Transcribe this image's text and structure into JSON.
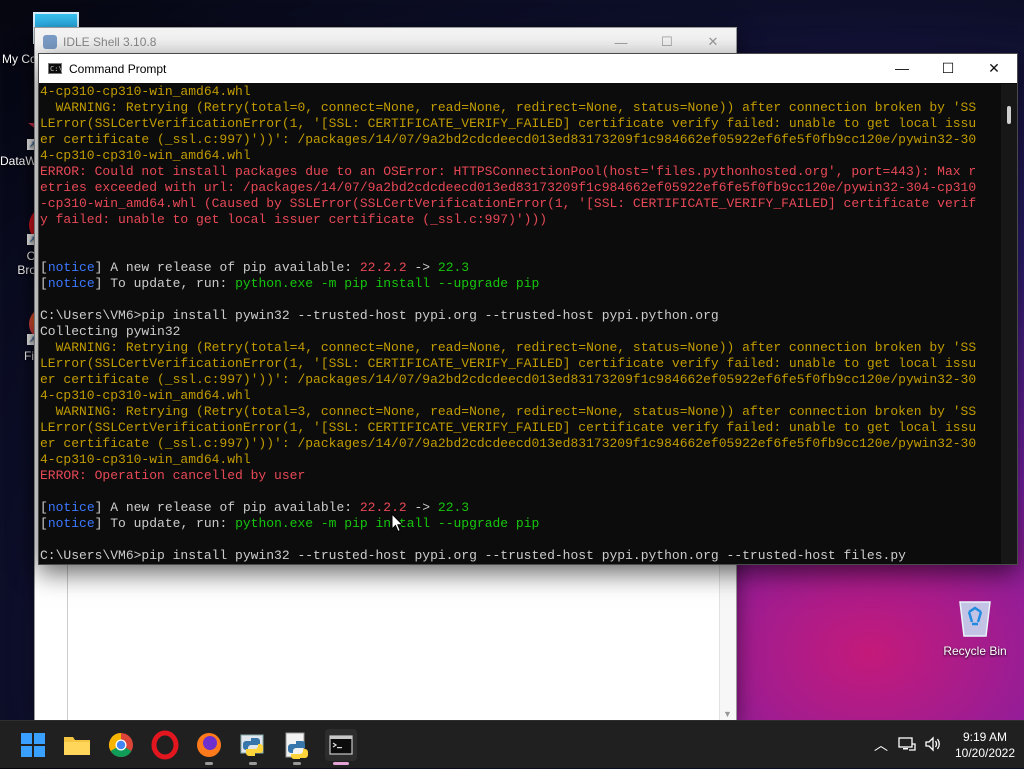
{
  "desktop": {
    "icons": [
      {
        "label": "My Co"
      },
      {
        "label": "DataW"
      },
      {
        "label": "O\nBro"
      },
      {
        "label": "Fi"
      }
    ],
    "recycle_bin": {
      "label": "Recycle Bin"
    }
  },
  "idle_window": {
    "title": "IDLE Shell 3.10.8",
    "minimize": "—",
    "maximize": "☐",
    "close": "✕"
  },
  "cmd_window": {
    "title": "Command Prompt",
    "icon_text": "C:\\",
    "minimize": "—",
    "maximize": "☐",
    "close": "✕",
    "lines": [
      [
        {
          "t": "4-cp310-cp310-win_amd64.whl",
          "c": "y"
        }
      ],
      [
        {
          "t": "  WARNING: Retrying (Retry(total=0, connect=None, read=None, redirect=None, status=None)) after connection broken by 'SS",
          "c": "y"
        }
      ],
      [
        {
          "t": "LError(SSLCertVerificationError(1, '[SSL: CERTIFICATE_VERIFY_FAILED] certificate verify failed: unable to get local issu",
          "c": "y"
        }
      ],
      [
        {
          "t": "er certificate (_ssl.c:997)'))': /packages/14/07/9a2bd2cdcdeecd013ed83173209f1c984662ef05922ef6fe5f0fb9cc120e/pywin32-30",
          "c": "y"
        }
      ],
      [
        {
          "t": "4-cp310-cp310-win_amd64.whl",
          "c": "y"
        }
      ],
      [
        {
          "t": "ERROR: Could not install packages due to an OSError: HTTPSConnectionPool(host='files.pythonhosted.org', port=443): Max r",
          "c": "r"
        }
      ],
      [
        {
          "t": "etries exceeded with url: /packages/14/07/9a2bd2cdcdeecd013ed83173209f1c984662ef05922ef6fe5f0fb9cc120e/pywin32-304-cp310",
          "c": "r"
        }
      ],
      [
        {
          "t": "-cp310-win_amd64.whl (Caused by SSLError(SSLCertVerificationError(1, '[SSL: CERTIFICATE_VERIFY_FAILED] certificate verif",
          "c": "r"
        }
      ],
      [
        {
          "t": "y failed: unable to get local issuer certificate (_ssl.c:997)')))",
          "c": "r"
        }
      ],
      [
        {
          "t": ""
        }
      ],
      [
        {
          "t": ""
        }
      ],
      [
        {
          "t": "["
        },
        {
          "t": "notice",
          "c": "b"
        },
        {
          "t": "] A new release of pip available: "
        },
        {
          "t": "22.2.2",
          "c": "r"
        },
        {
          "t": " -> "
        },
        {
          "t": "22.3",
          "c": "g"
        }
      ],
      [
        {
          "t": "["
        },
        {
          "t": "notice",
          "c": "b"
        },
        {
          "t": "] To update, run: "
        },
        {
          "t": "python.exe -m pip install --upgrade pip",
          "c": "g"
        }
      ],
      [
        {
          "t": ""
        }
      ],
      [
        {
          "t": "C:\\Users\\VM6>pip install pywin32 --trusted-host pypi.org --trusted-host pypi.python.org"
        }
      ],
      [
        {
          "t": "Collecting pywin32"
        }
      ],
      [
        {
          "t": "  WARNING: Retrying (Retry(total=4, connect=None, read=None, redirect=None, status=None)) after connection broken by 'SS",
          "c": "y"
        }
      ],
      [
        {
          "t": "LError(SSLCertVerificationError(1, '[SSL: CERTIFICATE_VERIFY_FAILED] certificate verify failed: unable to get local issu",
          "c": "y"
        }
      ],
      [
        {
          "t": "er certificate (_ssl.c:997)'))': /packages/14/07/9a2bd2cdcdeecd013ed83173209f1c984662ef05922ef6fe5f0fb9cc120e/pywin32-30",
          "c": "y"
        }
      ],
      [
        {
          "t": "4-cp310-cp310-win_amd64.whl",
          "c": "y"
        }
      ],
      [
        {
          "t": "  WARNING: Retrying (Retry(total=3, connect=None, read=None, redirect=None, status=None)) after connection broken by 'SS",
          "c": "y"
        }
      ],
      [
        {
          "t": "LError(SSLCertVerificationError(1, '[SSL: CERTIFICATE_VERIFY_FAILED] certificate verify failed: unable to get local issu",
          "c": "y"
        }
      ],
      [
        {
          "t": "er certificate (_ssl.c:997)'))': /packages/14/07/9a2bd2cdcdeecd013ed83173209f1c984662ef05922ef6fe5f0fb9cc120e/pywin32-30",
          "c": "y"
        }
      ],
      [
        {
          "t": "4-cp310-cp310-win_amd64.whl",
          "c": "y"
        }
      ],
      [
        {
          "t": "ERROR: Operation cancelled by user",
          "c": "r"
        }
      ],
      [
        {
          "t": ""
        }
      ],
      [
        {
          "t": "["
        },
        {
          "t": "notice",
          "c": "b"
        },
        {
          "t": "] A new release of pip available: "
        },
        {
          "t": "22.2.2",
          "c": "r"
        },
        {
          "t": " -> "
        },
        {
          "t": "22.3",
          "c": "g"
        }
      ],
      [
        {
          "t": "["
        },
        {
          "t": "notice",
          "c": "b"
        },
        {
          "t": "] To update, run: "
        },
        {
          "t": "python.exe -m pip install --upgrade pip",
          "c": "g"
        }
      ],
      [
        {
          "t": ""
        }
      ],
      [
        {
          "t": "C:\\Users\\VM6>pip install pywin32 --trusted-host pypi.org --trusted-host pypi.python.org --trusted-host files.py"
        }
      ]
    ]
  },
  "taskbar": {
    "apps": [
      {
        "name": "start",
        "icon": "windows-logo-icon"
      },
      {
        "name": "file-explorer",
        "icon": "folder-icon",
        "running": false
      },
      {
        "name": "chrome",
        "icon": "chrome-icon",
        "running": false
      },
      {
        "name": "opera",
        "icon": "opera-icon",
        "running": false
      },
      {
        "name": "firefox",
        "icon": "firefox-icon",
        "running": true
      },
      {
        "name": "python",
        "icon": "python-icon",
        "running": true
      },
      {
        "name": "idle",
        "icon": "idle-icon",
        "running": true
      },
      {
        "name": "command-prompt",
        "icon": "terminal-icon",
        "running": true,
        "active": true
      }
    ],
    "tray": {
      "chevron": "︿",
      "time": "9:19 AM",
      "date": "10/20/2022"
    }
  },
  "colors": {
    "terminal_bg": "#0c0c0c",
    "terminal_fg": "#cccccc",
    "warning": "#c19c00",
    "error": "#e74856",
    "notice": "#3b78ff",
    "success": "#16c60c",
    "taskbar": "#202020"
  }
}
